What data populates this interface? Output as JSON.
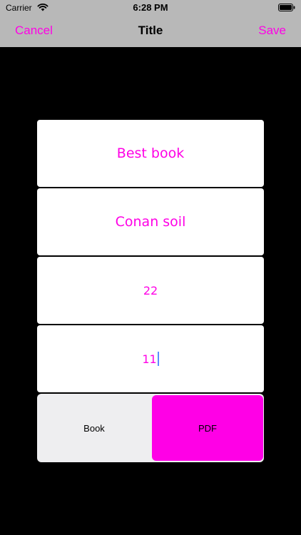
{
  "status_bar": {
    "carrier": "Carrier",
    "time": "6:28 PM",
    "icons": [
      "wifi-icon",
      "battery-icon"
    ]
  },
  "nav_bar": {
    "cancel_label": "Cancel",
    "title": "Title",
    "save_label": "Save"
  },
  "form": {
    "fields": [
      {
        "value": "Best book"
      },
      {
        "value": "Conan soil"
      },
      {
        "value": "22"
      },
      {
        "value": "11"
      }
    ],
    "format_selector": {
      "options": [
        "Book",
        "PDF"
      ],
      "selected": "PDF"
    }
  },
  "colors": {
    "accent": "#ff00e6",
    "bar_background": "#b8b8b8",
    "page_background": "#000000",
    "field_background": "#ffffff",
    "segment_background": "#eeeef0"
  }
}
